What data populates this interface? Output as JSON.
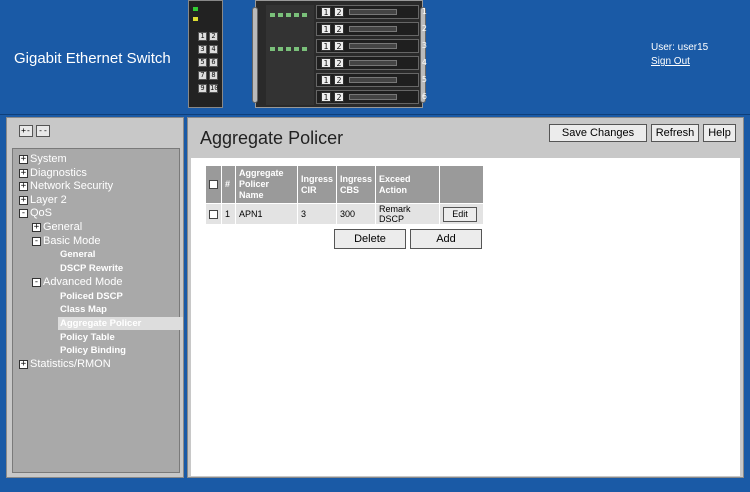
{
  "header": {
    "app_title": "Gigabit Ethernet Switch",
    "user_label": "User: user15",
    "sign_out": "Sign Out"
  },
  "device": {
    "small_panel_ports": [
      "1",
      "2",
      "3",
      "4",
      "5",
      "6",
      "7",
      "8",
      "9",
      "10"
    ],
    "chassis_slots": [
      {
        "a": "1",
        "b": "2",
        "num": "1"
      },
      {
        "a": "1",
        "b": "2",
        "num": "2"
      },
      {
        "a": "1",
        "b": "2",
        "num": "3"
      },
      {
        "a": "1",
        "b": "2",
        "num": "4"
      },
      {
        "a": "1",
        "b": "2",
        "num": "5"
      },
      {
        "a": "1",
        "b": "2",
        "num": "6"
      }
    ]
  },
  "nav": {
    "expand_all": "+-",
    "collapse_all": "--",
    "items": [
      {
        "label": "System",
        "box": "+"
      },
      {
        "label": "Diagnostics",
        "box": "+"
      },
      {
        "label": "Network Security",
        "box": "+"
      },
      {
        "label": "Layer 2",
        "box": "+"
      },
      {
        "label": "QoS",
        "box": "-"
      },
      {
        "label": "General",
        "box": "+"
      },
      {
        "label": "Basic Mode",
        "box": "-"
      },
      {
        "label": "General"
      },
      {
        "label": "DSCP Rewrite"
      },
      {
        "label": "Advanced Mode",
        "box": "-"
      },
      {
        "label": "Policed DSCP"
      },
      {
        "label": "Class Map"
      },
      {
        "label": "Aggregate Policer"
      },
      {
        "label": "Policy Table"
      },
      {
        "label": "Policy Binding"
      },
      {
        "label": "Statistics/RMON",
        "box": "+"
      }
    ]
  },
  "main": {
    "title": "Aggregate Policer",
    "save_changes": "Save Changes",
    "refresh": "Refresh",
    "help": "Help",
    "table": {
      "headers": [
        "#",
        "Aggregate Policer Name",
        "Ingress CIR",
        "Ingress CBS",
        "Exceed Action"
      ],
      "rows": [
        {
          "num": "1",
          "name": "APN1",
          "cir": "3",
          "cbs": "300",
          "action": "Remark DSCP",
          "edit": "Edit"
        }
      ]
    },
    "delete": "Delete",
    "add": "Add"
  }
}
